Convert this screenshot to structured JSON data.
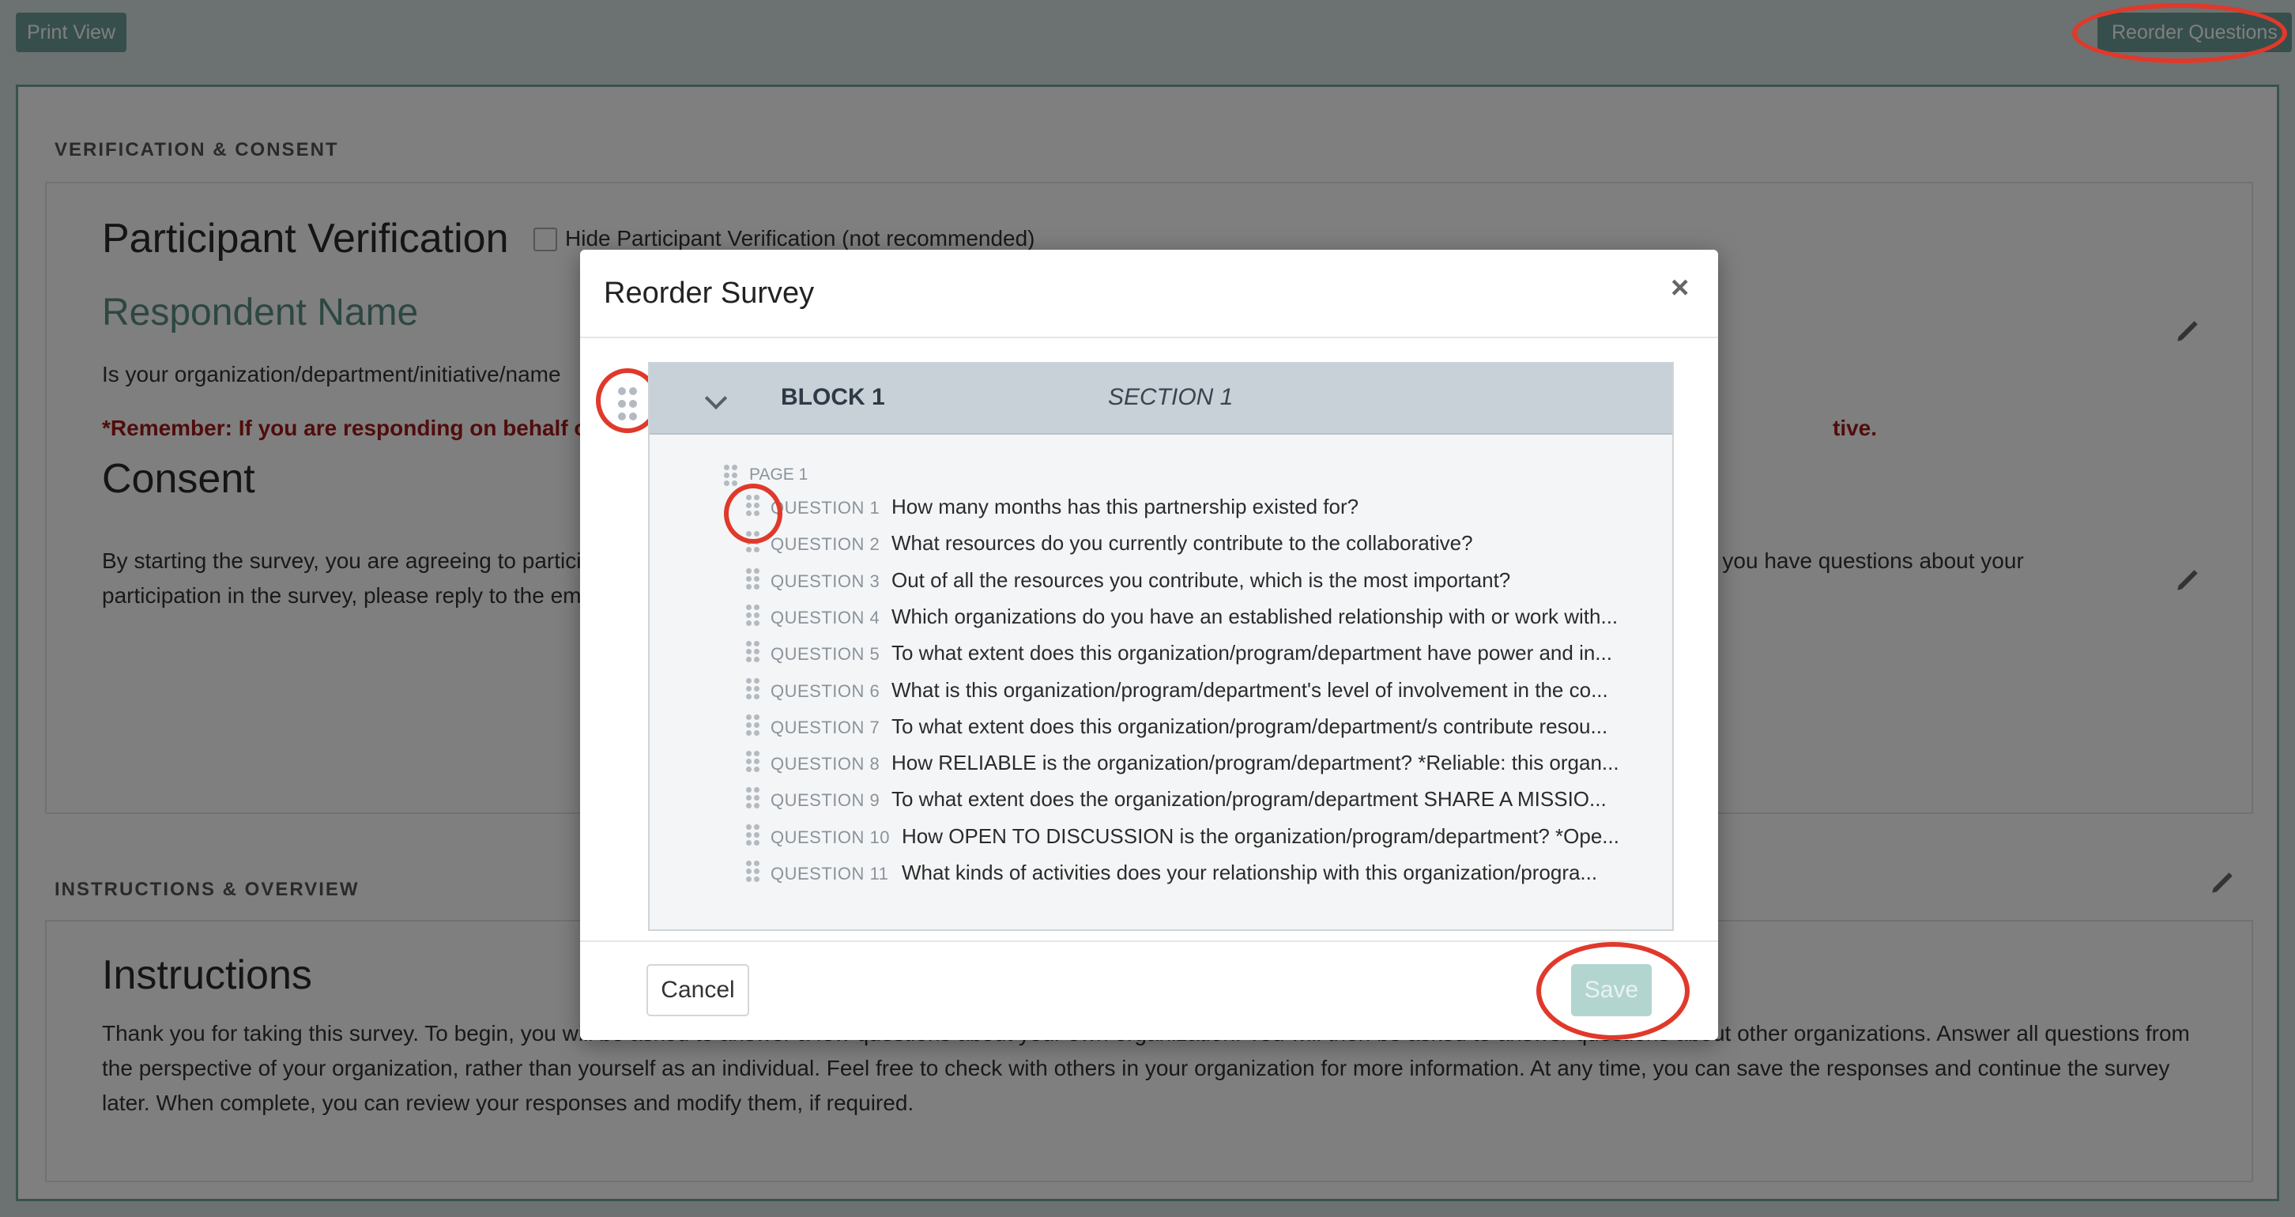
{
  "toolbar": {
    "print_view": "Print View",
    "reorder_questions": "Reorder Questions"
  },
  "sections": {
    "verification": {
      "label": "VERIFICATION & CONSENT",
      "participant_title": "Participant Verification",
      "hide_checkbox_label": "Hide Participant Verification (not recommended)",
      "respondent_name": "Respondent Name",
      "respondent_question": "Is your organization/department/initiative/name",
      "remember_left": "*Remember: If you are responding on behalf of a",
      "remember_right": "tive.",
      "consent_title": "Consent",
      "consent_left_1": "By starting the survey, you are agreeing to partici",
      "consent_right_1": "vey. If you have questions about your",
      "consent_left_2": "participation in the survey, please reply to the em"
    },
    "instructions": {
      "label": "INSTRUCTIONS & OVERVIEW",
      "title": "Instructions",
      "body_1": "Thank you for taking this survey. To begin, you will be asked to answer a few questions about your own organization. You will then be asked to answer questions about other organizations. Answer all questions from",
      "body_2": "the perspective of your organization, rather than yourself as an individual. Feel free to check with others in your organization for more information. At any time, you can save the responses and continue the survey",
      "body_3": "later. When complete, you can review your responses and modify them, if required."
    }
  },
  "modal": {
    "title": "Reorder Survey",
    "close": "×",
    "block_name": "BLOCK 1",
    "section_name": "SECTION 1",
    "page_label": "PAGE 1",
    "questions": [
      {
        "num": "QUESTION 1",
        "text": "How many months has this partnership existed for?"
      },
      {
        "num": "QUESTION 2",
        "text": "What resources do you currently contribute to the collaborative?"
      },
      {
        "num": "QUESTION 3",
        "text": "Out of all the resources you contribute, which is the most important?"
      },
      {
        "num": "QUESTION 4",
        "text": "Which organizations do you have an established relationship with or work with..."
      },
      {
        "num": "QUESTION 5",
        "text": "To what extent does this organization/program/department have power and in..."
      },
      {
        "num": "QUESTION 6",
        "text": "What is this organization/program/department's level of involvement in the co..."
      },
      {
        "num": "QUESTION 7",
        "text": "To what extent does this organization/program/department/s contribute resou..."
      },
      {
        "num": "QUESTION 8",
        "text": "How RELIABLE is the organization/program/department? *Reliable: this organ..."
      },
      {
        "num": "QUESTION 9",
        "text": "To what extent does the organization/program/department SHARE A MISSIO..."
      },
      {
        "num": "QUESTION 10",
        "text": "How OPEN TO DISCUSSION is the organization/program/department? *Ope..."
      },
      {
        "num": "QUESTION 11",
        "text": "What kinds of activities does your relationship with this organization/progra..."
      }
    ],
    "cancel": "Cancel",
    "save": "Save"
  },
  "colors": {
    "accent": "#6f9f98",
    "highlight": "#e0392b",
    "alert": "#a31818"
  }
}
